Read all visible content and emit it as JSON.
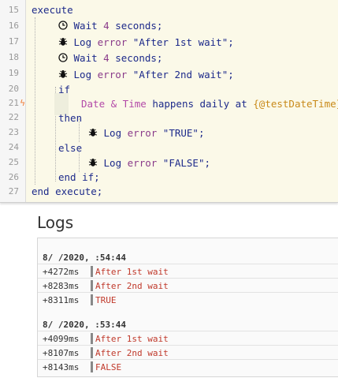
{
  "editor": {
    "line_numbers": [
      "15",
      "16",
      "17",
      "18",
      "19",
      "20",
      "21",
      "22",
      "23",
      "24",
      "25",
      "26",
      "27"
    ],
    "lines": {
      "execute": "execute",
      "wait1": {
        "pre": "Wait ",
        "num": "4",
        "post": " seconds;"
      },
      "log1": {
        "pre": "Log ",
        "lvl": "error",
        "msg": " \"After 1st wait\";"
      },
      "wait2": {
        "pre": "Wait ",
        "num": "4",
        "post": " seconds;"
      },
      "log2": {
        "pre": "Log ",
        "lvl": "error",
        "msg": " \"After 2nd wait\";"
      },
      "if": "if",
      "trigger": {
        "dt": "Date & Time",
        "mid": " happens daily at ",
        "var": "{@testDateTime}"
      },
      "then": "then",
      "log3": {
        "pre": "Log ",
        "lvl": "error",
        "msg": " \"TRUE\";"
      },
      "else": "else",
      "log4": {
        "pre": "Log ",
        "lvl": "error",
        "msg": " \"FALSE\";"
      },
      "endif": "end if;",
      "endexec": "end execute;"
    }
  },
  "logs": {
    "title": "Logs",
    "groups": [
      {
        "header": "8/ /2020,  :54:44",
        "rows": [
          {
            "time": "+4272ms",
            "msg": "After 1st wait"
          },
          {
            "time": "+8283ms",
            "msg": "After 2nd wait"
          },
          {
            "time": "+8311ms",
            "msg": "TRUE"
          }
        ]
      },
      {
        "header": "8/ /2020,  :53:44",
        "rows": [
          {
            "time": "+4099ms",
            "msg": "After 1st wait"
          },
          {
            "time": "+8107ms",
            "msg": "After 2nd wait"
          },
          {
            "time": "+8143ms",
            "msg": "FALSE"
          }
        ]
      }
    ]
  }
}
